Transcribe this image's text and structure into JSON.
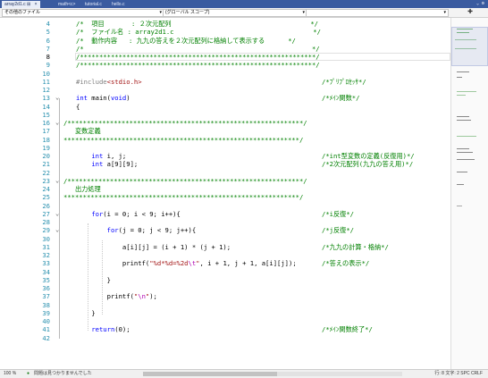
{
  "tabs": [
    {
      "label": "array2d1.c",
      "active": true,
      "pin": "⊞",
      "close": "×"
    },
    {
      "label": "math&lt;c&gt;"
    },
    {
      "label": "tutorial.c"
    },
    {
      "label": "hello.c"
    }
  ],
  "tabbar_right": "⌄ ⚙",
  "navbar": {
    "project": "その他のファイル",
    "scope": "(グローバル スコープ)",
    "member": "",
    "split": "✚"
  },
  "code_lines": [
    {
      "n": "4",
      "text": "/*  項目       : ２次元配列                                    */",
      "cls": "cmt"
    },
    {
      "n": "5",
      "text": "/*  ファイル名 : array2d1.c                                    */",
      "cls": "cmt"
    },
    {
      "n": "6",
      "text": "/*  動作内容   : 九九の答えを２次元配列に格納して表示する      */",
      "cls": "cmt"
    },
    {
      "n": "7",
      "text": "/*                                                           */",
      "cls": "cmt"
    },
    {
      "n": "8",
      "text": "/*************************************************************/",
      "cls": "cmt",
      "cur": true
    },
    {
      "n": "9",
      "text": "/*************************************************************/",
      "cls": "cmt"
    },
    {
      "n": "10",
      "text": ""
    },
    {
      "n": "11",
      "text": "#include<stdio.h>",
      "rc": "/*ﾌﾟﾘﾌﾟﾛｾｯｻ*/",
      "inc": true
    },
    {
      "n": "12",
      "text": ""
    },
    {
      "n": "13",
      "text": "int main(void)",
      "rc": "/*ﾒｲﾝ関数*/",
      "kwline": true,
      "fold": "⌄"
    },
    {
      "n": "14",
      "text": "{"
    },
    {
      "n": "15",
      "text": ""
    },
    {
      "n": "16",
      "text": "/*************************************************************/",
      "cls": "cmt",
      "fold": "⌄",
      "indent": -14
    },
    {
      "n": "17",
      "text": "   変数定義",
      "cls": "cmt",
      "indent": -14
    },
    {
      "n": "18",
      "text": "*************************************************************/",
      "cls": "cmt",
      "indent": -14
    },
    {
      "n": "19",
      "text": ""
    },
    {
      "n": "20",
      "text": "    int i, j;",
      "rc": "/*int型変数の定義(反復用)*/",
      "kwint": true
    },
    {
      "n": "21",
      "text": "    int a[9][9];",
      "rc": "/*2次元配列(九九の答え用)*/",
      "kwint": true
    },
    {
      "n": "22",
      "text": ""
    },
    {
      "n": "23",
      "text": "/*************************************************************/",
      "cls": "cmt",
      "fold": "⌄",
      "indent": -14
    },
    {
      "n": "24",
      "text": "   出力処理",
      "cls": "cmt",
      "indent": -14
    },
    {
      "n": "25",
      "text": "*************************************************************/",
      "cls": "cmt",
      "indent": -14
    },
    {
      "n": "26",
      "text": ""
    },
    {
      "n": "27",
      "text": "    for(i = 0; i < 9; i++){",
      "rc": "/*i反復*/",
      "kwfor": true,
      "fold": "⌄"
    },
    {
      "n": "28",
      "text": ""
    },
    {
      "n": "29",
      "text": "        for(j = 0; j < 9; j++){",
      "rc": "/*j反復*/",
      "kwfor": true,
      "fold": "⌄"
    },
    {
      "n": "30",
      "text": ""
    },
    {
      "n": "31",
      "text": "            a[i][j] = (i + 1) * (j + 1);",
      "rc": "/*九九の計算・格納*/"
    },
    {
      "n": "32",
      "text": ""
    },
    {
      "n": "33",
      "text": "            printf(\"%d*%d=%2d\\t\", i + 1, j + 1, a[i][j]);",
      "rc": "/*答えの表示*/",
      "printf": true
    },
    {
      "n": "34",
      "text": ""
    },
    {
      "n": "35",
      "text": "        }"
    },
    {
      "n": "36",
      "text": ""
    },
    {
      "n": "37",
      "text": "        printf(\"\\n\");",
      "printf2": true
    },
    {
      "n": "38",
      "text": ""
    },
    {
      "n": "39",
      "text": "    }"
    },
    {
      "n": "40",
      "text": ""
    },
    {
      "n": "41",
      "text": "    return(0);",
      "rc": "/*ﾒｲﾝ関数終了*/",
      "kwret": true
    },
    {
      "n": "42",
      "text": ""
    }
  ],
  "status": {
    "zoom": "100 %",
    "issues": "問題は見つかりませんでした",
    "position": "行: 8   文字: 2   SPC   CRLF"
  }
}
